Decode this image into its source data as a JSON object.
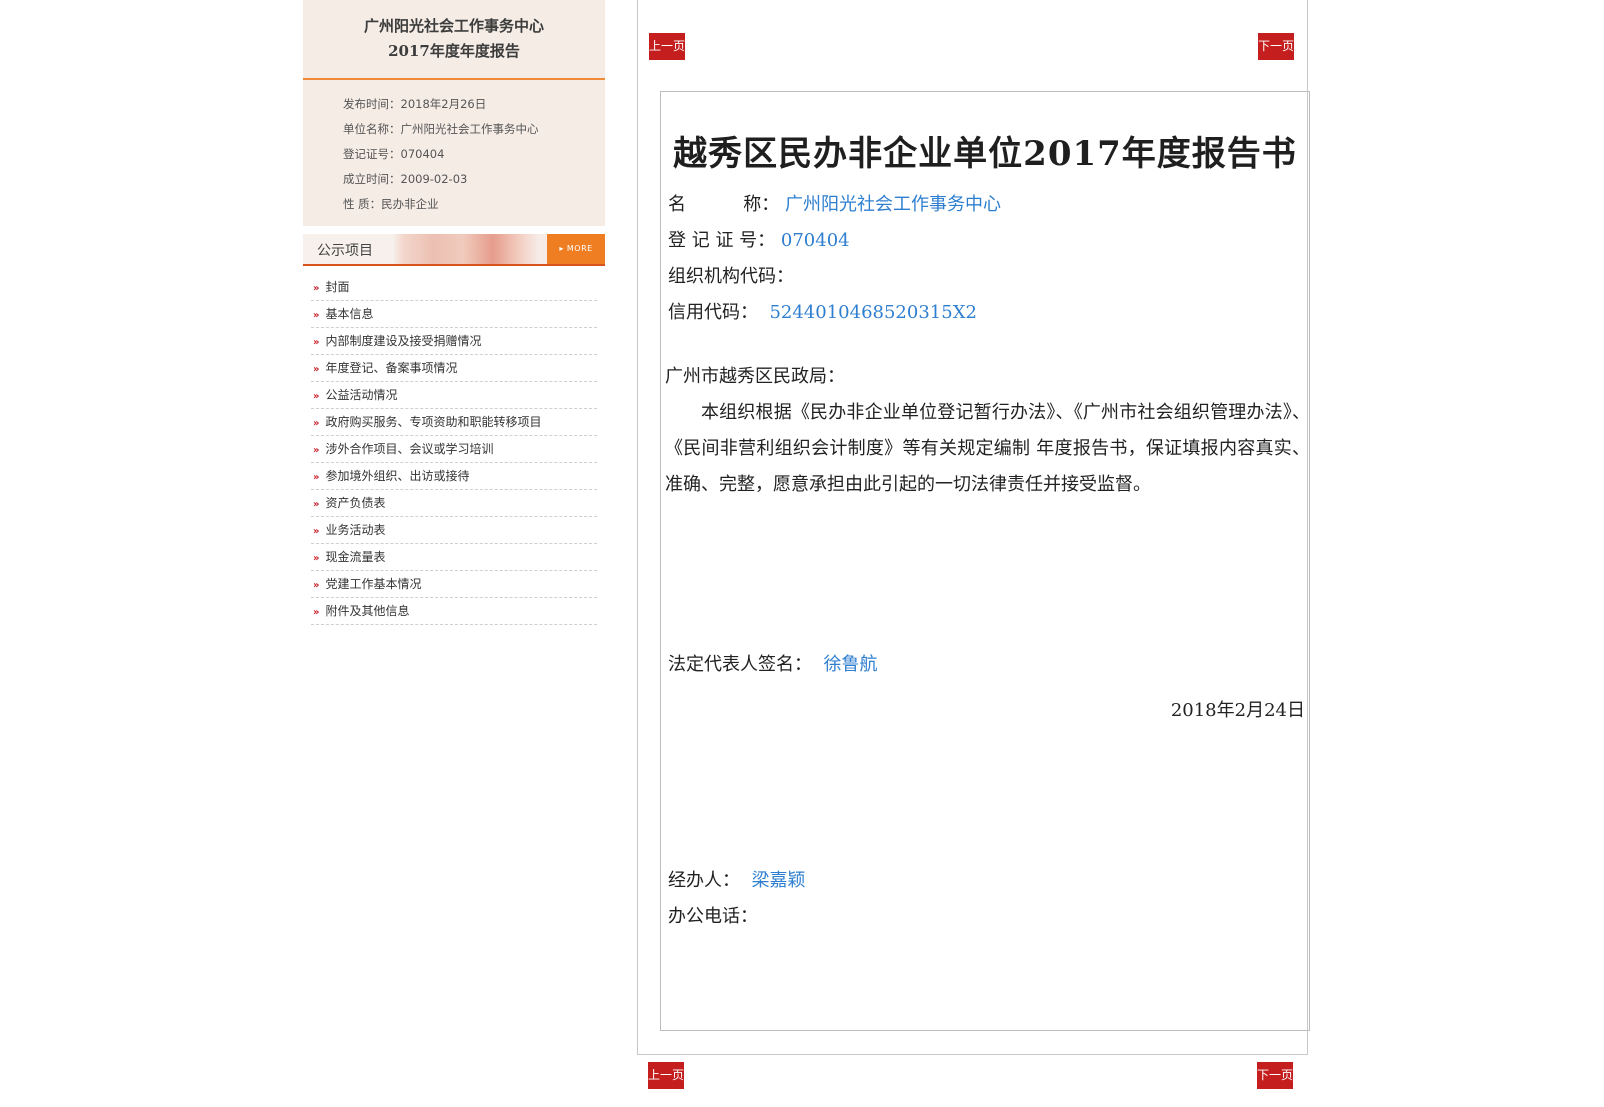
{
  "sidebar": {
    "header_line1": "广州阳光社会工作事务中心",
    "header_line2": "2017年度年度报告",
    "info": [
      {
        "label": "发布时间：",
        "value": "2018年2月26日"
      },
      {
        "label": "单位名称：",
        "value": "广州阳光社会工作事务中心"
      },
      {
        "label": "登记证号：",
        "value": "070404"
      },
      {
        "label": "成立时间：",
        "value": "2009-02-03"
      },
      {
        "label": "性  质：",
        "value": "民办非企业"
      }
    ],
    "nav_title": "公示项目",
    "more_label": "▸ MORE",
    "nav_items": [
      "封面",
      "基本信息",
      "内部制度建设及接受捐赠情况",
      "年度登记、备案事项情况",
      "公益活动情况",
      "政府购买服务、专项资助和职能转移项目",
      "涉外合作项目、会议或学习培训",
      "参加境外组织、出访或接待",
      "资产负债表",
      "业务活动表",
      "现金流量表",
      "党建工作基本情况",
      "附件及其他信息"
    ]
  },
  "pager": {
    "prev": "上一页",
    "next": "下一页"
  },
  "doc": {
    "title": "越秀区民办非企业单位2017年度报告书",
    "name_label": "名          称：",
    "name_value": "广州阳光社会工作事务中心",
    "reg_label": "登 记 证 号：",
    "reg_value": "070404",
    "org_label": "组织机构代码：",
    "credit_label": "信用代码：",
    "credit_value": "5244010468520315X2",
    "addressee": "广州市越秀区民政局：",
    "body": "本组织根据《民办非企业单位登记暂行办法》、《广州市社会组织管理办法》、《民间非营利组织会计制度》等有关规定编制 年度报告书，保证填报内容真实、准确、完整，愿意承担由此引起的一切法律责任并接受监督。",
    "rep_label": "法定代表人签名：",
    "rep_value": "徐鲁航",
    "date": "2018年2月24日",
    "handler_label": "经办人：",
    "handler_value": "梁嘉颖",
    "phone_label": "办公电话："
  }
}
